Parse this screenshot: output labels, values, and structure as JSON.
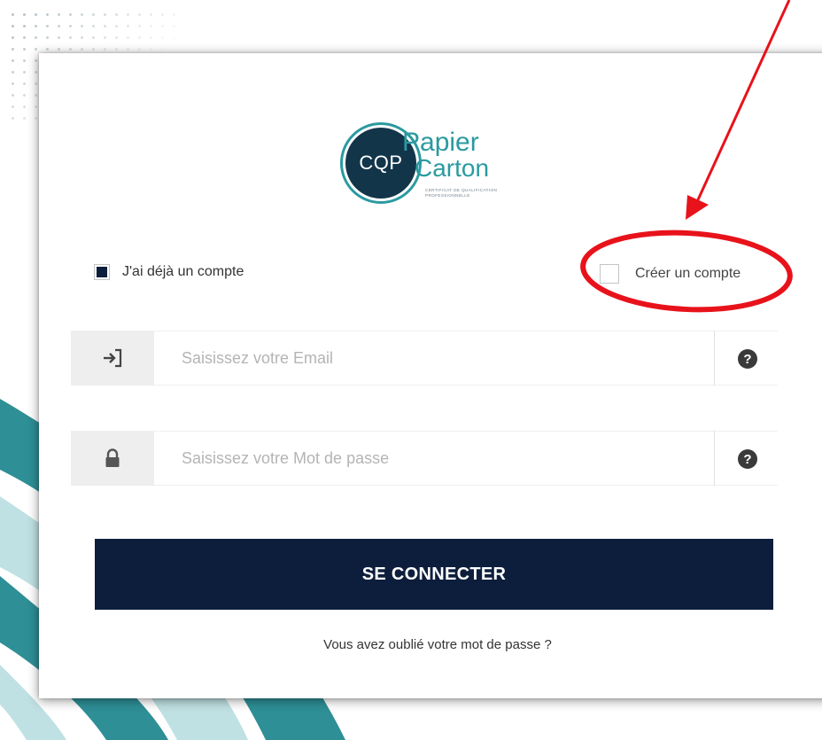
{
  "logo": {
    "badge_text": "CQP",
    "line1": "Papier",
    "line2": "Carton",
    "subtitle": "CERTIFICAT DE QUALIFICATION PROFESSIONNELLE"
  },
  "account_choice": {
    "existing": {
      "label": "J'ai déjà un compte",
      "checked": true
    },
    "create": {
      "label": "Créer un compte",
      "checked": false
    }
  },
  "email_field": {
    "placeholder": "Saisissez votre Email",
    "value": "",
    "icon": "login-arrow-icon",
    "help_glyph": "?"
  },
  "password_field": {
    "placeholder": "Saisissez votre Mot de passe",
    "value": "",
    "icon": "lock-icon",
    "help_glyph": "?"
  },
  "submit": {
    "label": "SE CONNECTER"
  },
  "forgot_link": {
    "label": "Vous avez oublié votre mot de passe ?"
  },
  "colors": {
    "brand_navy": "#0d1e3c",
    "brand_teal": "#2a9aa0",
    "annotation_red": "#e8121b"
  }
}
